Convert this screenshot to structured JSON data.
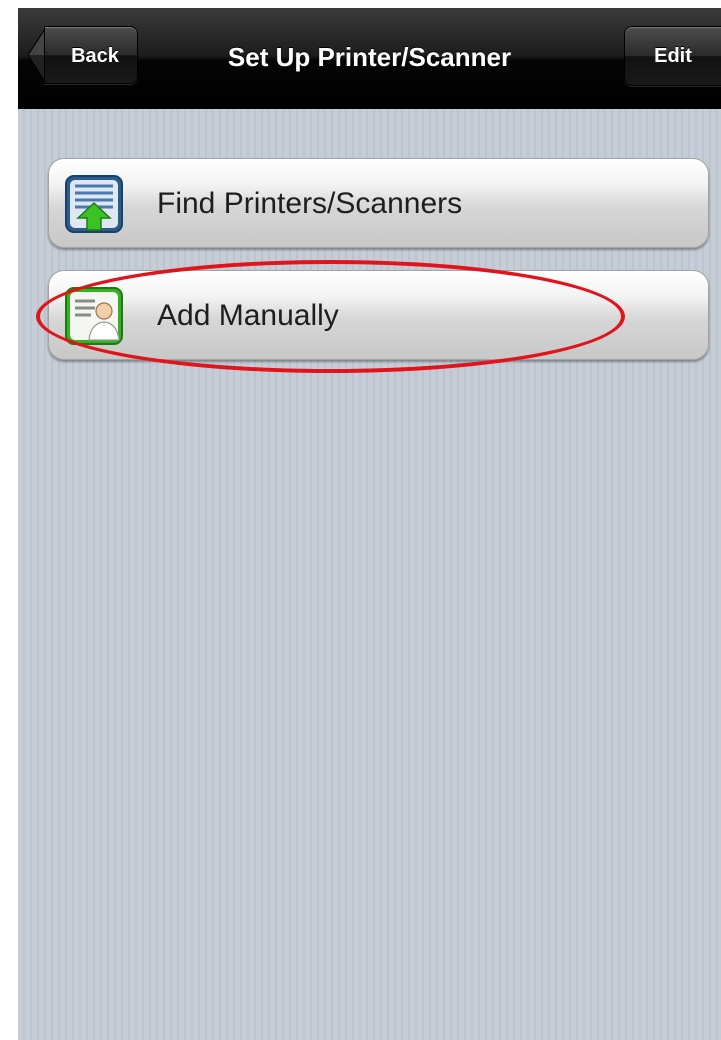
{
  "navbar": {
    "back_label": "Back",
    "title": "Set Up Printer/Scanner",
    "edit_label": "Edit"
  },
  "menu": {
    "items": [
      {
        "label": "Find Printers/Scanners",
        "icon": "find-printers-icon"
      },
      {
        "label": "Add Manually",
        "icon": "add-manually-icon"
      }
    ]
  },
  "annotation": {
    "color": "#e0141a",
    "target": "Add Manually"
  },
  "colors": {
    "navbar": "#000000",
    "background": "#c5ccd6",
    "accent_green": "#35b021",
    "accent_blue": "#2a5d8f"
  }
}
